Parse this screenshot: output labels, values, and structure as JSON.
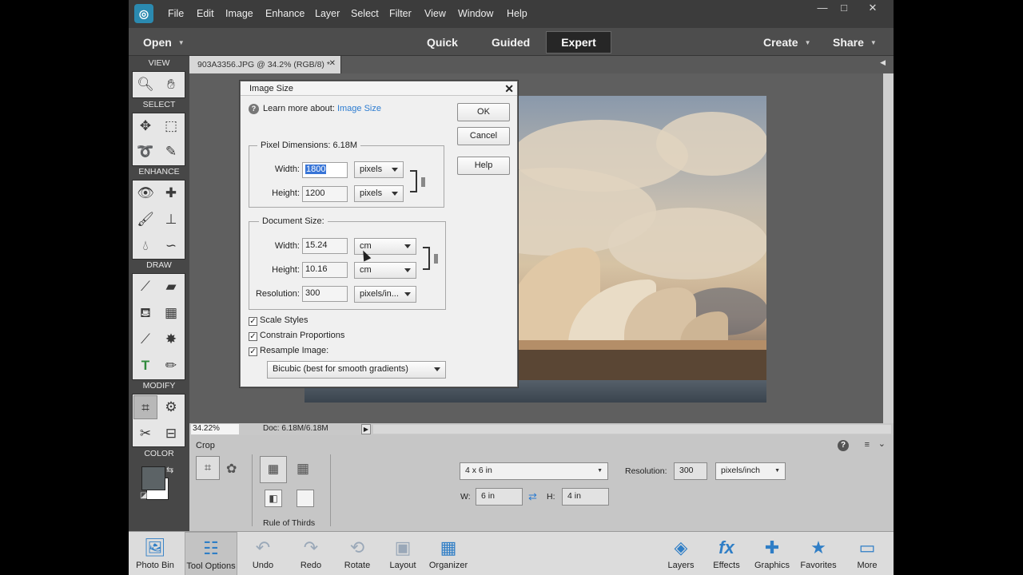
{
  "menu": [
    "File",
    "Edit",
    "Image",
    "Enhance",
    "Layer",
    "Select",
    "Filter",
    "View",
    "Window",
    "Help"
  ],
  "window_controls": {
    "minimize": "—",
    "maximize": "□",
    "close": "✕"
  },
  "modes": {
    "open": "Open",
    "quick": "Quick",
    "guided": "Guided",
    "expert": "Expert",
    "create": "Create",
    "share": "Share"
  },
  "toolbox": {
    "view": "VIEW",
    "select": "SELECT",
    "enhance": "ENHANCE",
    "draw": "DRAW",
    "modify": "MODIFY",
    "color": "COLOR"
  },
  "document": {
    "tab_title": "903A3356.JPG @ 34.2% (RGB/8) *",
    "close": "✕"
  },
  "status": {
    "zoom": "34.22%",
    "doc_size": "Doc: 6.18M/6.18M"
  },
  "tool_options": {
    "title": "Crop",
    "grid_label": "Rule of Thirds",
    "preset": "4 x 6 in",
    "width_label": "W:",
    "width_value": "6 in",
    "height_label": "H:",
    "height_value": "4 in",
    "resolution_label": "Resolution:",
    "resolution_value": "300",
    "resolution_unit": "pixels/inch"
  },
  "bottom_bar": {
    "photo_bin": "Photo Bin",
    "tool_options": "Tool Options",
    "undo": "Undo",
    "redo": "Redo",
    "rotate": "Rotate",
    "layout": "Layout",
    "organizer": "Organizer",
    "layers": "Layers",
    "effects": "Effects",
    "graphics": "Graphics",
    "favorites": "Favorites",
    "more": "More"
  },
  "dialog": {
    "title": "Image Size",
    "learn_more": "Learn more about:",
    "learn_link": "Image Size",
    "ok": "OK",
    "cancel": "Cancel",
    "help": "Help",
    "pixel_dimensions": {
      "legend": "Pixel Dimensions:  6.18M",
      "width_label": "Width:",
      "width_value": "1800",
      "width_unit": "pixels",
      "height_label": "Height:",
      "height_value": "1200",
      "height_unit": "pixels"
    },
    "document_size": {
      "legend": "Document Size:",
      "width_label": "Width:",
      "width_value": "15.24",
      "width_unit": "cm",
      "height_label": "Height:",
      "height_value": "10.16",
      "height_unit": "cm",
      "resolution_label": "Resolution:",
      "resolution_value": "300",
      "resolution_unit": "pixels/in..."
    },
    "scale_styles": "Scale Styles",
    "constrain_proportions": "Constrain Proportions",
    "resample_image": "Resample Image:",
    "resample_method": "Bicubic (best for smooth gradients)",
    "checked_mark": "✓"
  },
  "colors": {
    "accent": "#2c7cd1",
    "app_bg": "#4a4a4a",
    "foreground_swatch": "#5c6366",
    "background_swatch": "#ffffff"
  }
}
